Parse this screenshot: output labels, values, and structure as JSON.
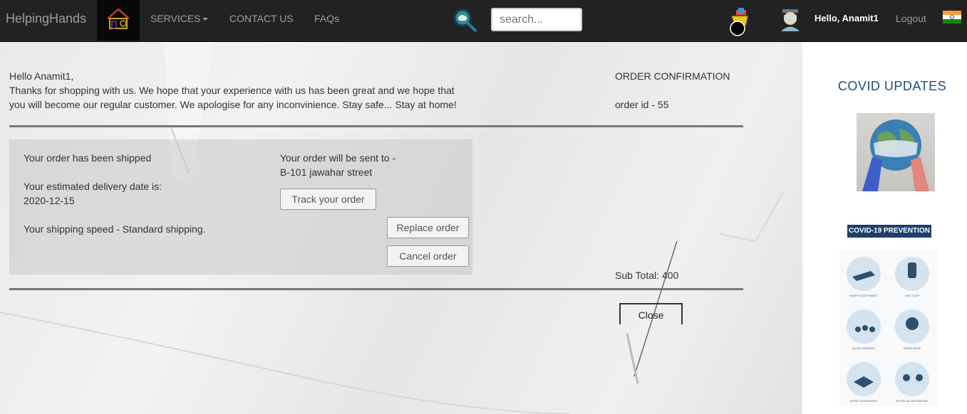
{
  "navbar": {
    "brand": "HelpingHands",
    "links": {
      "services": "SERVICES",
      "contact": "CONTACT US",
      "faqs": "FAQs"
    },
    "search_placeholder": "search...",
    "greeting": "Hello, Anamit1",
    "logout": "Logout"
  },
  "order": {
    "greeting": "Hello Anamit1,",
    "message_line1": "Thanks for shopping with us. We hope that your experience with us has been great and we hope that",
    "message_line2": "you will become our regular customer. We apologise for any inconvinience. Stay safe... Stay at home!",
    "heading": "ORDER CONFIRMATION",
    "order_id": "order id - 55",
    "status": "Your order has been shipped",
    "delivery_label": "Your estimated delivery date is:",
    "delivery_date": "2020-12-15",
    "shipping_speed": "Your shipping speed - Standard shipping.",
    "sent_to_label": "Your order will be sent to -",
    "address": "B-101 jawahar street",
    "buttons": {
      "track": "Track your order",
      "replace": "Replace order",
      "cancel": "Cancel order",
      "close": "Close"
    },
    "subtotal": "Sub Total: 400"
  },
  "sidebar": {
    "title": "COVID UPDATES",
    "prevention_badge": "COVID-19 PREVENTION",
    "poster_captions": [
      "WASH YOUR HANDS",
      "USE SOAP",
      "AVOID CROWDS",
      "WEAR MASK",
      "AVOID HANDSHAKE",
      "PHYSICAL DISTANCING"
    ]
  },
  "colors": {
    "navbar_bg": "#222222",
    "nav_text": "#9d9d9d",
    "covid_title": "#1f4e79",
    "badge_bg": "#1f3e6a"
  },
  "icons": {
    "brand_logo": "house-logo-icon",
    "search": "magnifier-virus-icon",
    "cart": "shopping-cart-icon",
    "avatar": "user-avatar-icon",
    "flag": "india-flag-icon"
  }
}
